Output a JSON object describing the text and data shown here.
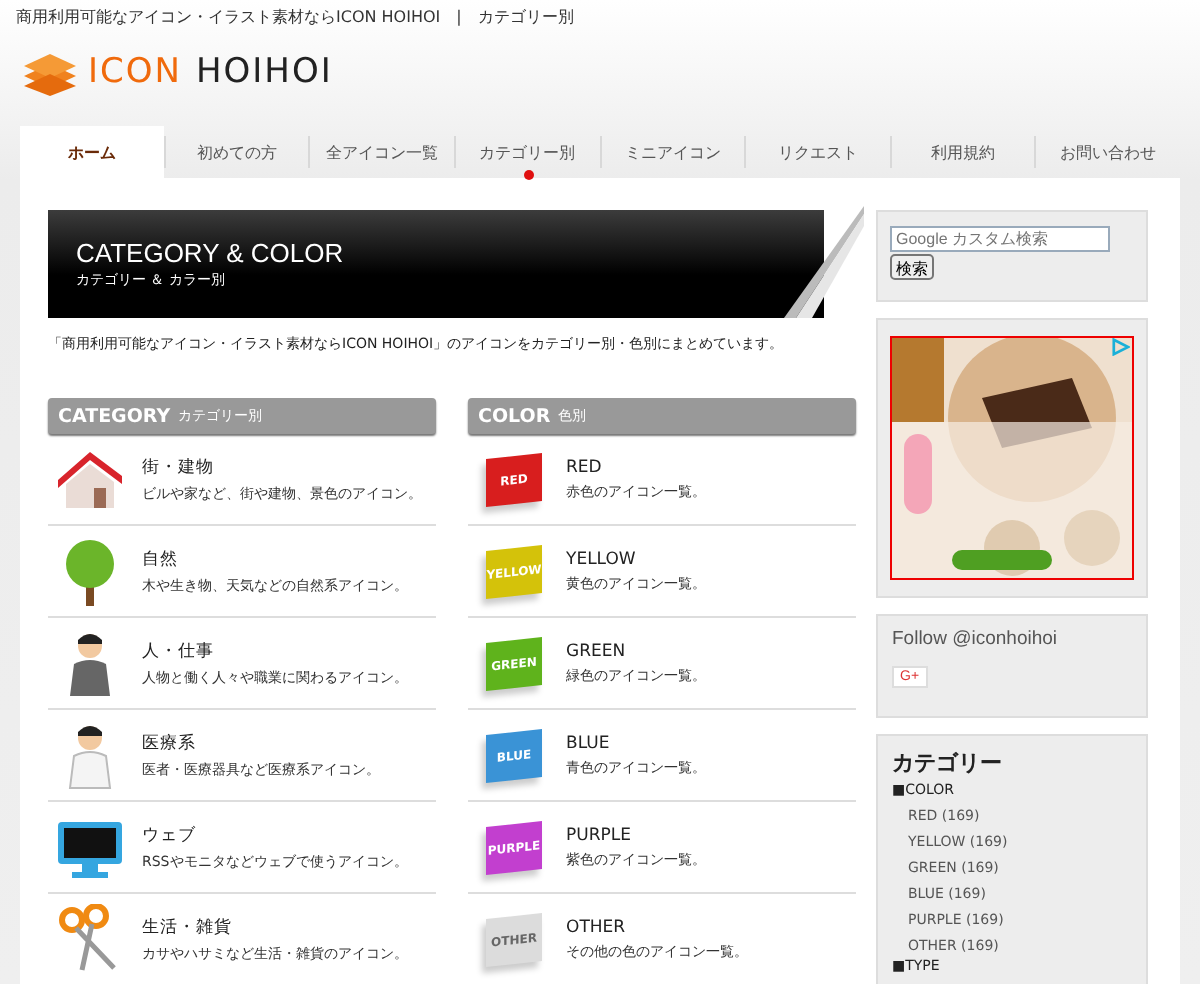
{
  "top_text": "商用利用可能なアイコン・イラスト素材ならICON HOIHOI　|　カテゴリー別",
  "logo": {
    "part_1": "ICON",
    "part_2": "HOIHOI"
  },
  "tabs": [
    {
      "label": "ホーム",
      "selected": true,
      "marked": false
    },
    {
      "label": "初めての方",
      "selected": false,
      "marked": false
    },
    {
      "label": "全アイコン一覧",
      "selected": false,
      "marked": false
    },
    {
      "label": "カテゴリー別",
      "selected": false,
      "marked": true
    },
    {
      "label": "ミニアイコン",
      "selected": false,
      "marked": false
    },
    {
      "label": "リクエスト",
      "selected": false,
      "marked": false
    },
    {
      "label": "利用規約",
      "selected": false,
      "marked": false
    },
    {
      "label": "お問い合わせ",
      "selected": false,
      "marked": false
    }
  ],
  "banner": {
    "title": "CATEGORY & COLOR",
    "subtitle": "カテゴリー ＆ カラー別"
  },
  "description": "「商用利用可能なアイコン・イラスト素材ならICON HOIHOI」のアイコンをカテゴリー別・色別にまとめています。",
  "category": {
    "heading": "CATEGORY",
    "heading_sub": "カテゴリー別",
    "items": [
      {
        "kind": "house",
        "title": "街・建物",
        "text": "ビルや家など、街や建物、景色のアイコン。"
      },
      {
        "kind": "tree",
        "title": "自然",
        "text": "木や生き物、天気などの自然系アイコン。"
      },
      {
        "kind": "person",
        "title": "人・仕事",
        "text": "人物と働く人々や職業に関わるアイコン。"
      },
      {
        "kind": "doctor",
        "title": "医療系",
        "text": "医者・医療器具など医療系アイコン。"
      },
      {
        "kind": "monitor",
        "title": "ウェブ",
        "text": "RSSやモニタなどウェブで使うアイコン。"
      },
      {
        "kind": "scissors",
        "title": "生活・雑貨",
        "text": "カサやハサミなど生活・雑貨のアイコン。"
      }
    ]
  },
  "color": {
    "heading": "COLOR",
    "heading_sub": "色別",
    "items": [
      {
        "badge": "RED",
        "color": "#d81e1e",
        "title": "RED",
        "text": "赤色のアイコン一覧。"
      },
      {
        "badge": "YELLOW",
        "color": "#d4c20a",
        "title": "YELLOW",
        "text": "黄色のアイコン一覧。"
      },
      {
        "badge": "GREEN",
        "color": "#5fb31c",
        "title": "GREEN",
        "text": "緑色のアイコン一覧。"
      },
      {
        "badge": "BLUE",
        "color": "#3a93d6",
        "title": "BLUE",
        "text": "青色のアイコン一覧。"
      },
      {
        "badge": "PURPLE",
        "color": "#c23fcf",
        "title": "PURPLE",
        "text": "紫色のアイコン一覧。"
      },
      {
        "badge": "OTHER",
        "color": "#dcdcdc",
        "title": "OTHER",
        "text": "その他の色のアイコン一覧。"
      }
    ]
  },
  "search": {
    "placeholder": "Google カスタム検索",
    "button": "検索"
  },
  "follow": {
    "text": "Follow @iconhoihoi",
    "button": "G+"
  },
  "sidebar_categories": {
    "title": "カテゴリー",
    "groups": [
      {
        "label": "■COLOR",
        "children": [
          {
            "label": "RED (169)"
          },
          {
            "label": "YELLOW (169)"
          },
          {
            "label": "GREEN (169)"
          },
          {
            "label": "BLUE (169)"
          },
          {
            "label": "PURPLE (169)"
          },
          {
            "label": "OTHER (169)"
          }
        ]
      },
      {
        "label": "■TYPE"
      }
    ]
  }
}
